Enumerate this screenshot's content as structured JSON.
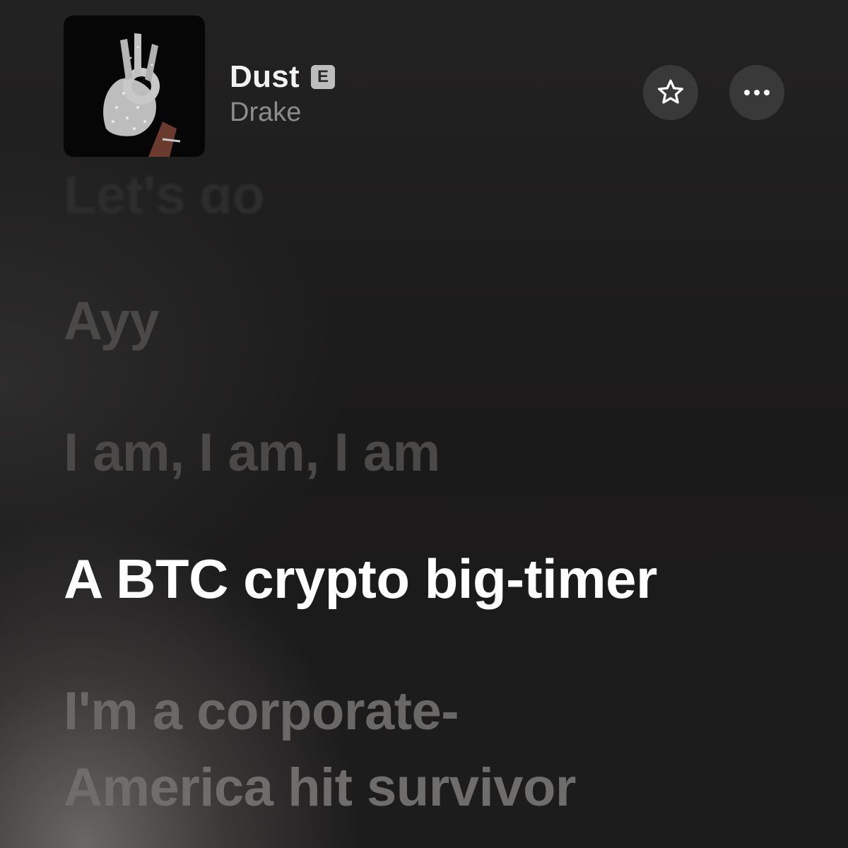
{
  "now_playing": {
    "title": "Dust",
    "explicit_label": "E",
    "artist": "Drake",
    "artwork_icon": "glove-ok-hand-artwork"
  },
  "actions": {
    "favorite_icon": "star-icon",
    "more_icon": "ellipsis-icon"
  },
  "lyrics": {
    "previous_clipped": "Let's go",
    "line_1": "Ayy",
    "line_2": "I am, I am, I am",
    "active": "A BTC crypto big-timer",
    "next_1": "I'm a corporate-",
    "next_2": "America hit survivor"
  },
  "colors": {
    "active_lyric": "#ffffff",
    "inactive_lyric": "#4a4948",
    "button_bg": "#3a3939",
    "background": "#1c1b1b"
  }
}
